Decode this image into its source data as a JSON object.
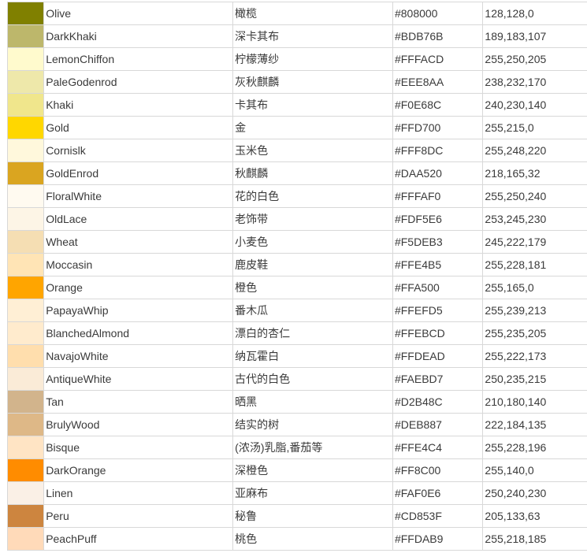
{
  "rows": [
    {
      "swatch": "#808000",
      "name": "Olive",
      "cn": "橄榄",
      "hex": "#808000",
      "rgb": "128,128,0"
    },
    {
      "swatch": "#BDB76B",
      "name": "DarkKhaki",
      "cn": "深卡其布",
      "hex": "#BDB76B",
      "rgb": "189,183,107"
    },
    {
      "swatch": "#FFFACD",
      "name": "LemonChiffon",
      "cn": "柠檬薄纱",
      "hex": "#FFFACD",
      "rgb": "255,250,205"
    },
    {
      "swatch": "#EEE8AA",
      "name": "PaleGodenrod",
      "cn": "灰秋麒麟",
      "hex": "#EEE8AA",
      "rgb": "238,232,170"
    },
    {
      "swatch": "#F0E68C",
      "name": "Khaki",
      "cn": "卡其布",
      "hex": "#F0E68C",
      "rgb": "240,230,140"
    },
    {
      "swatch": "#FFD700",
      "name": "Gold",
      "cn": "金",
      "hex": "#FFD700",
      "rgb": "255,215,0"
    },
    {
      "swatch": "#FFF8DC",
      "name": "Cornislk",
      "cn": "玉米色",
      "hex": "#FFF8DC",
      "rgb": "255,248,220"
    },
    {
      "swatch": "#DAA520",
      "name": "GoldEnrod",
      "cn": "秋麒麟",
      "hex": "#DAA520",
      "rgb": "218,165,32"
    },
    {
      "swatch": "#FFFAF0",
      "name": "FloralWhite",
      "cn": "花的白色",
      "hex": "#FFFAF0",
      "rgb": "255,250,240"
    },
    {
      "swatch": "#FDF5E6",
      "name": "OldLace",
      "cn": "老饰带",
      "hex": "#FDF5E6",
      "rgb": "253,245,230"
    },
    {
      "swatch": "#F5DEB3",
      "name": "Wheat",
      "cn": "小麦色",
      "hex": "#F5DEB3",
      "rgb": "245,222,179"
    },
    {
      "swatch": "#FFE4B5",
      "name": "Moccasin",
      "cn": "鹿皮鞋",
      "hex": "#FFE4B5",
      "rgb": "255,228,181"
    },
    {
      "swatch": "#FFA500",
      "name": "Orange",
      "cn": "橙色",
      "hex": "#FFA500",
      "rgb": "255,165,0"
    },
    {
      "swatch": "#FFEFD5",
      "name": "PapayaWhip",
      "cn": "番木瓜",
      "hex": "#FFEFD5",
      "rgb": "255,239,213"
    },
    {
      "swatch": "#FFEBCD",
      "name": "BlanchedAlmond",
      "cn": "漂白的杏仁",
      "hex": "#FFEBCD",
      "rgb": "255,235,205"
    },
    {
      "swatch": "#FFDEAD",
      "name": "NavajoWhite",
      "cn": "纳瓦霍白",
      "hex": "#FFDEAD",
      "rgb": "255,222,173"
    },
    {
      "swatch": "#FAEBD7",
      "name": "AntiqueWhite",
      "cn": "古代的白色",
      "hex": "#FAEBD7",
      "rgb": "250,235,215"
    },
    {
      "swatch": "#D2B48C",
      "name": "Tan",
      "cn": "晒黑",
      "hex": "#D2B48C",
      "rgb": "210,180,140"
    },
    {
      "swatch": "#DEB887",
      "name": "BrulyWood",
      "cn": "结实的树",
      "hex": "#DEB887",
      "rgb": "222,184,135"
    },
    {
      "swatch": "#FFE4C4",
      "name": "Bisque",
      "cn": "(浓汤)乳脂,番茄等",
      "hex": "#FFE4C4",
      "rgb": "255,228,196"
    },
    {
      "swatch": "#FF8C00",
      "name": "DarkOrange",
      "cn": "深橙色",
      "hex": "#FF8C00",
      "rgb": "255,140,0"
    },
    {
      "swatch": "#FAF0E6",
      "name": "Linen",
      "cn": "亚麻布",
      "hex": "#FAF0E6",
      "rgb": "250,240,230"
    },
    {
      "swatch": "#CD853F",
      "name": "Peru",
      "cn": "秘鲁",
      "hex": "#CD853F",
      "rgb": "205,133,63"
    },
    {
      "swatch": "#FFDAB9",
      "name": "PeachPuff",
      "cn": "桃色",
      "hex": "#FFDAB9",
      "rgb": "255,218,185"
    }
  ]
}
